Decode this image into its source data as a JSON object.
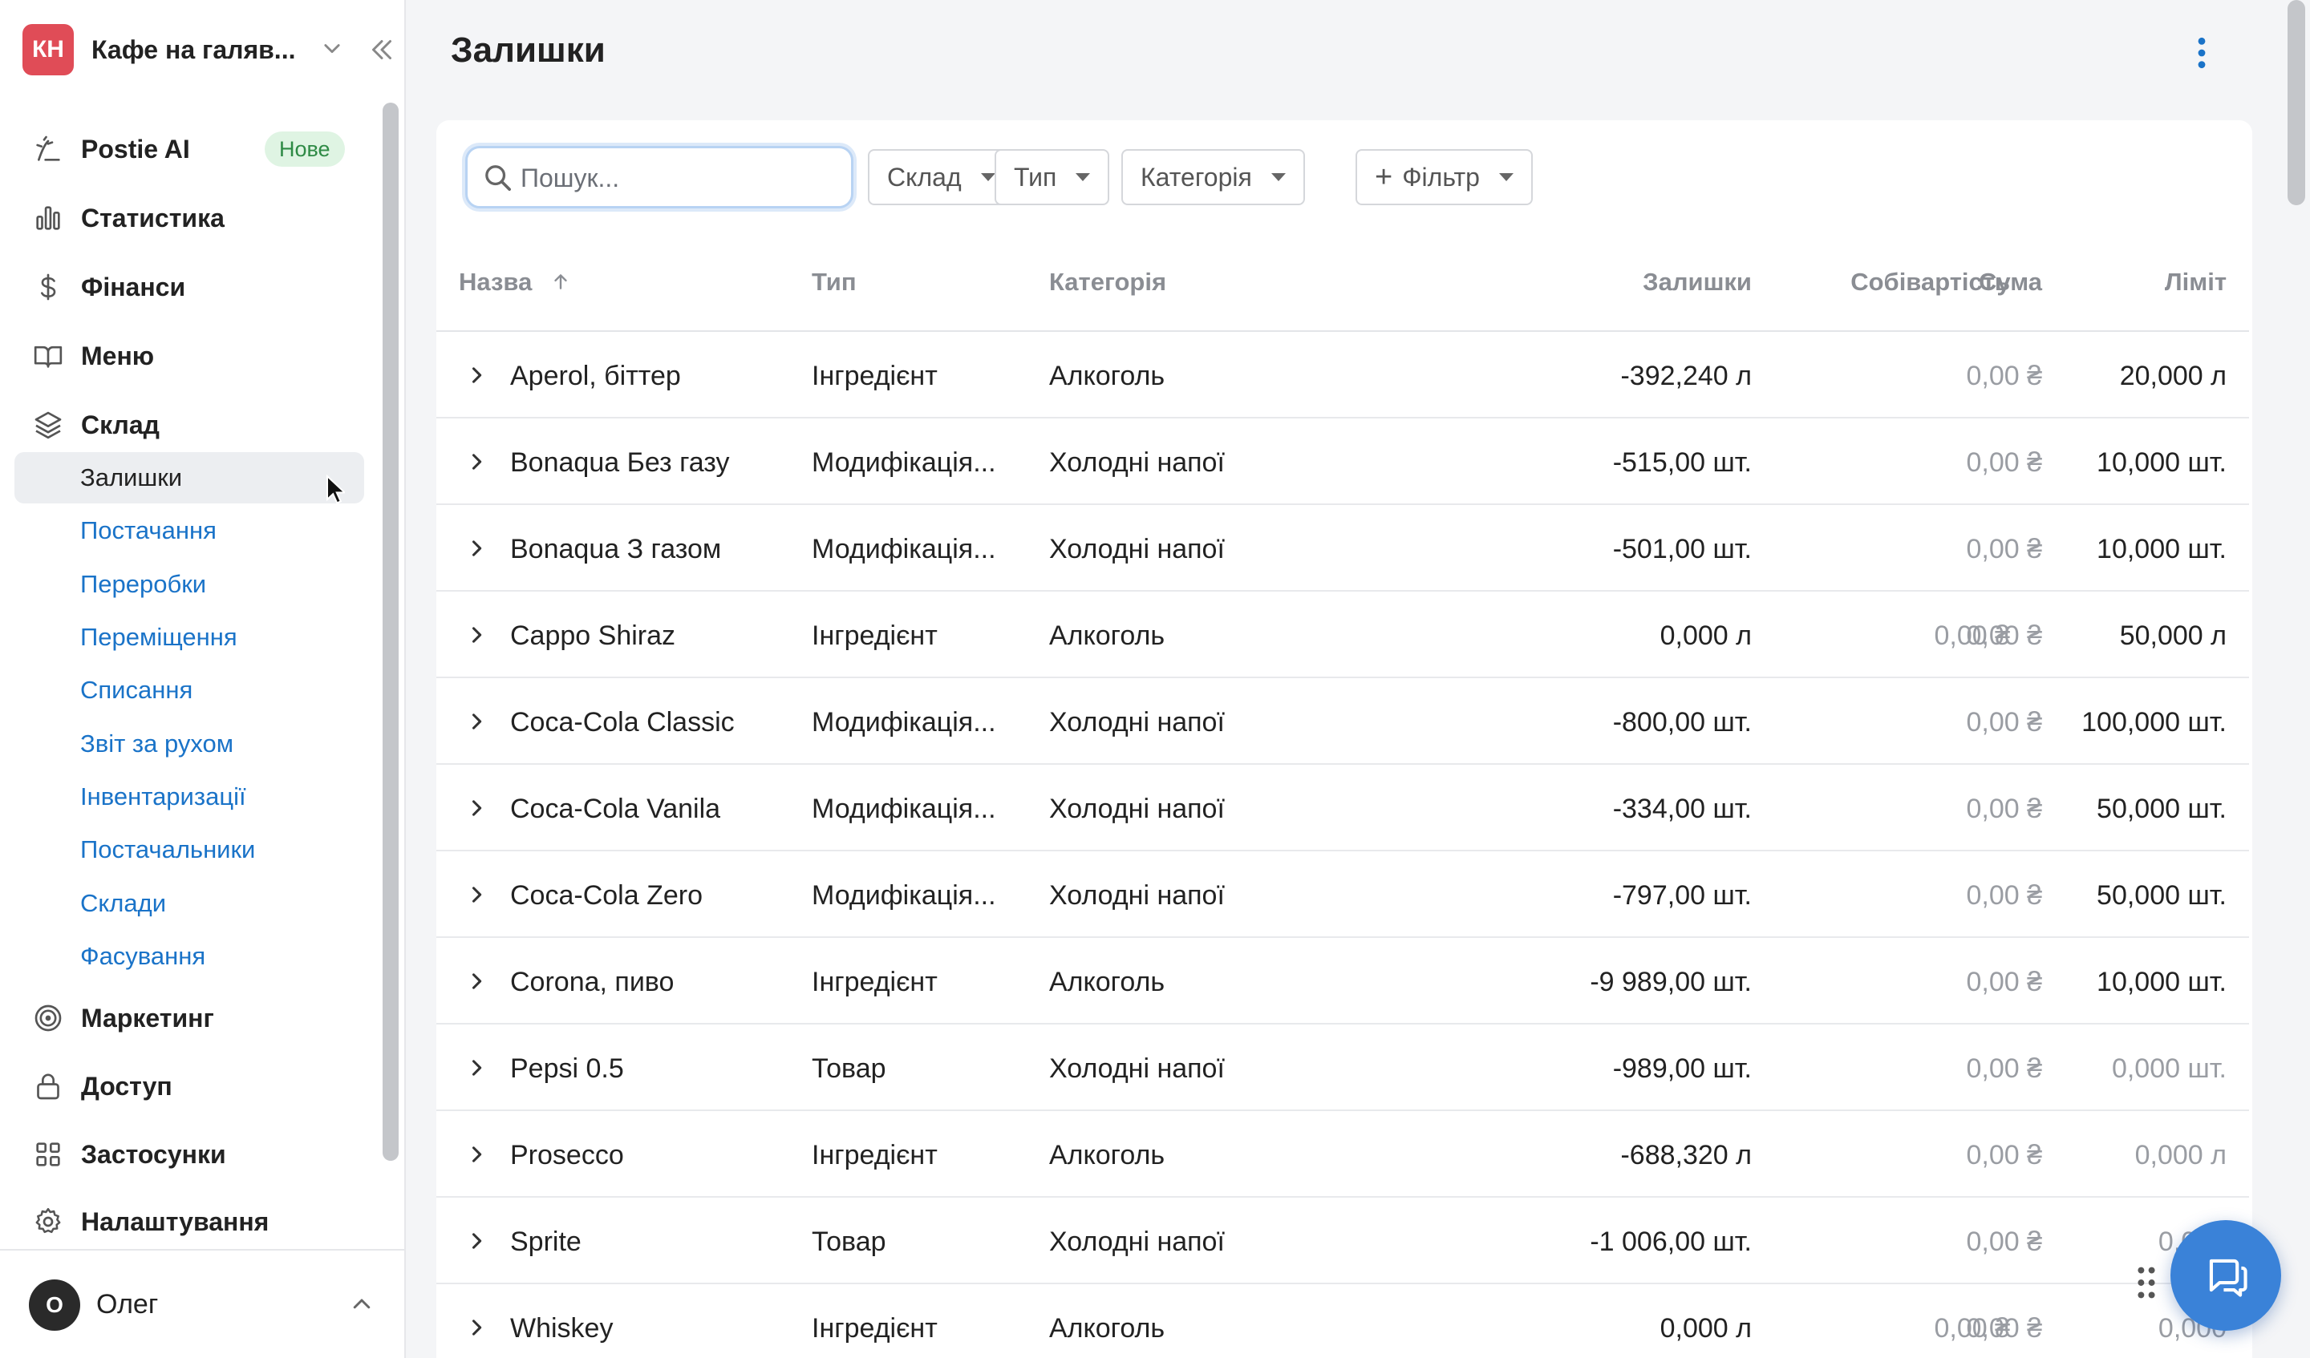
{
  "venue": {
    "initials": "КН",
    "name": "Кафе на галяв...",
    "brand_color": "#e04c57"
  },
  "nav": {
    "items": [
      {
        "label": "Postie AI",
        "icon": "ai-sparkle-icon",
        "badge": "Нове"
      },
      {
        "label": "Статистика",
        "icon": "bar-chart-icon"
      },
      {
        "label": "Фінанси",
        "icon": "dollar-icon"
      },
      {
        "label": "Меню",
        "icon": "book-icon"
      },
      {
        "label": "Склад",
        "icon": "layers-icon"
      }
    ],
    "warehouse_sub": [
      "Залишки",
      "Постачання",
      "Переробки",
      "Переміщення",
      "Списання",
      "Звіт за рухом",
      "Інвентаризації",
      "Постачальники",
      "Склади",
      "Фасування"
    ],
    "items_bottom": [
      {
        "label": "Маркетинг",
        "icon": "target-icon"
      },
      {
        "label": "Доступ",
        "icon": "lock-icon"
      },
      {
        "label": "Застосунки",
        "icon": "grid-icon"
      },
      {
        "label": "Налаштування",
        "icon": "gear-icon"
      }
    ],
    "active_sub": "Залишки"
  },
  "user": {
    "initial": "О",
    "name": "Олег"
  },
  "page": {
    "title": "Залишки"
  },
  "toolbar": {
    "search_placeholder": "Пошук...",
    "filters": [
      "Склад",
      "Тип",
      "Категорія"
    ],
    "add_filter": "Фільтр"
  },
  "table": {
    "columns": [
      "Назва",
      "Тип",
      "Категорія",
      "Залишки",
      "Собівартість",
      "Сума",
      "Ліміт"
    ],
    "sort_column": "Назва",
    "sort_direction": "asc",
    "rows": [
      {
        "name": "Aperol, біттер",
        "type": "Інгредієнт",
        "category": "Алкоголь",
        "stock": "-392,240 л",
        "cost": "",
        "sum": "0,00 ₴",
        "limit": "20,000 л",
        "limit_muted": false
      },
      {
        "name": "Bonaqua Без газу",
        "type": "Модифікація...",
        "category": "Холодні напої",
        "stock": "-515,00 шт.",
        "cost": "",
        "sum": "0,00 ₴",
        "limit": "10,000 шт.",
        "limit_muted": false
      },
      {
        "name": "Bonaqua З газом",
        "type": "Модифікація...",
        "category": "Холодні напої",
        "stock": "-501,00 шт.",
        "cost": "",
        "sum": "0,00 ₴",
        "limit": "10,000 шт.",
        "limit_muted": false
      },
      {
        "name": "Cappo Shiraz",
        "type": "Інгредієнт",
        "category": "Алкоголь",
        "stock": "0,000 л",
        "cost": "0,00 ₴",
        "sum": "0,00 ₴",
        "limit": "50,000 л",
        "limit_muted": false
      },
      {
        "name": "Coca-Cola Classic",
        "type": "Модифікація...",
        "category": "Холодні напої",
        "stock": "-800,00 шт.",
        "cost": "",
        "sum": "0,00 ₴",
        "limit": "100,000 шт.",
        "limit_muted": false
      },
      {
        "name": "Coca-Cola Vanila",
        "type": "Модифікація...",
        "category": "Холодні напої",
        "stock": "-334,00 шт.",
        "cost": "",
        "sum": "0,00 ₴",
        "limit": "50,000 шт.",
        "limit_muted": false
      },
      {
        "name": "Coca-Cola Zero",
        "type": "Модифікація...",
        "category": "Холодні напої",
        "stock": "-797,00 шт.",
        "cost": "",
        "sum": "0,00 ₴",
        "limit": "50,000 шт.",
        "limit_muted": false
      },
      {
        "name": "Corona, пиво",
        "type": "Інгредієнт",
        "category": "Алкоголь",
        "stock": "-9 989,00 шт.",
        "cost": "",
        "sum": "0,00 ₴",
        "limit": "10,000 шт.",
        "limit_muted": false
      },
      {
        "name": "Pepsi 0.5",
        "type": "Товар",
        "category": "Холодні напої",
        "stock": "-989,00 шт.",
        "cost": "",
        "sum": "0,00 ₴",
        "limit": "0,000 шт.",
        "limit_muted": true
      },
      {
        "name": "Prosecco",
        "type": "Інгредієнт",
        "category": "Алкоголь",
        "stock": "-688,320 л",
        "cost": "",
        "sum": "0,00 ₴",
        "limit": "0,000 л",
        "limit_muted": true
      },
      {
        "name": "Sprite",
        "type": "Товар",
        "category": "Холодні напої",
        "stock": "-1 006,00 шт.",
        "cost": "",
        "sum": "0,00 ₴",
        "limit": "0,000",
        "limit_muted": true
      },
      {
        "name": "Whiskey",
        "type": "Інгредієнт",
        "category": "Алкоголь",
        "stock": "0,000 л",
        "cost": "0,00 ₴",
        "sum": "0,00 ₴",
        "limit": "0,000",
        "limit_muted": true
      }
    ]
  },
  "colors": {
    "link": "#1a73c8",
    "chat_button": "#3a82d8",
    "badge_bg": "#dff4e3",
    "badge_text": "#2e8a45"
  }
}
